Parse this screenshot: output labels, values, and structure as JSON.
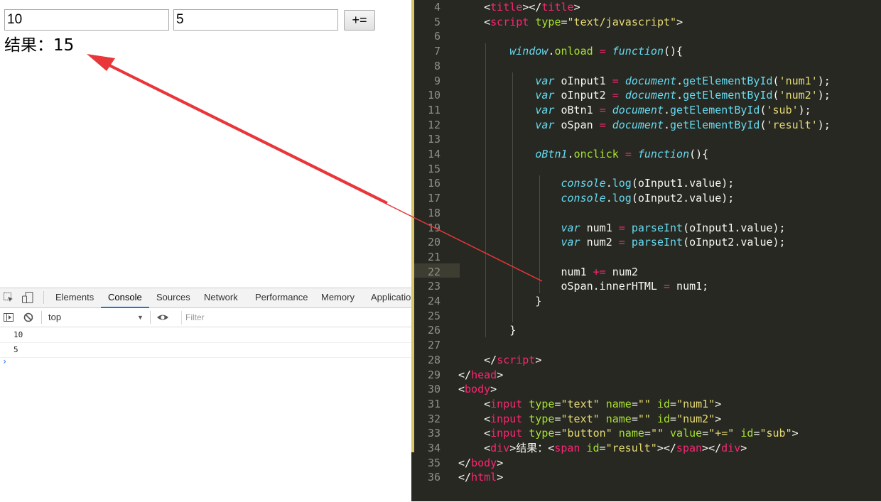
{
  "page": {
    "input1_value": "10",
    "input2_value": "5",
    "button_label": "+=",
    "result_text": "结果：15"
  },
  "devtools": {
    "tabs": [
      "Elements",
      "Console",
      "Sources",
      "Network",
      "Performance",
      "Memory",
      "Application"
    ],
    "active_tab": "Console",
    "context": "top",
    "filter_placeholder": "Filter",
    "logs": [
      "10",
      "5"
    ],
    "prompt": "›"
  },
  "editor": {
    "lines": [
      {
        "n": "4",
        "html": "    <span class='p'>&lt;</span><span class='t'>title</span><span class='p'>&gt;&lt;/</span><span class='t'>title</span><span class='p'>&gt;</span>"
      },
      {
        "n": "5",
        "html": "    <span class='p'>&lt;</span><span class='t'>script</span> <span class='a'>type</span><span class='p'>=</span><span class='s'>\"text/javascript\"</span><span class='p'>&gt;</span>"
      },
      {
        "n": "6",
        "html": ""
      },
      {
        "n": "7",
        "html": "        <span class='i'>window</span>.<span class='g'>onload</span> <span class='o'>=</span> <span class='i'>function</span>(){"
      },
      {
        "n": "8",
        "html": ""
      },
      {
        "n": "9",
        "html": "            <span class='i'>var</span> oInput1 <span class='o'>=</span> <span class='i'>document</span>.<span class='f'>getElementById</span>(<span class='s'>'num1'</span>);"
      },
      {
        "n": "10",
        "html": "            <span class='i'>var</span> oInput2 <span class='o'>=</span> <span class='i'>document</span>.<span class='f'>getElementById</span>(<span class='s'>'num2'</span>);"
      },
      {
        "n": "11",
        "html": "            <span class='i'>var</span> oBtn1 <span class='o'>=</span> <span class='i'>document</span>.<span class='f'>getElementById</span>(<span class='s'>'sub'</span>);"
      },
      {
        "n": "12",
        "html": "            <span class='i'>var</span> oSpan <span class='o'>=</span> <span class='i'>document</span>.<span class='f'>getElementById</span>(<span class='s'>'result'</span>);"
      },
      {
        "n": "13",
        "html": ""
      },
      {
        "n": "14",
        "html": "            <span class='i'>oBtn1</span>.<span class='g'>onclick</span> <span class='o'>=</span> <span class='i'>function</span>(){"
      },
      {
        "n": "15",
        "html": ""
      },
      {
        "n": "16",
        "html": "                <span class='i'>console</span>.<span class='f'>log</span>(oInput1.value);"
      },
      {
        "n": "17",
        "html": "                <span class='i'>console</span>.<span class='f'>log</span>(oInput2.value);"
      },
      {
        "n": "18",
        "html": ""
      },
      {
        "n": "19",
        "html": "                <span class='i'>var</span> num1 <span class='o'>=</span> <span class='f'>parseInt</span>(oInput1.value);"
      },
      {
        "n": "20",
        "html": "                <span class='i'>var</span> num2 <span class='o'>=</span> <span class='f'>parseInt</span>(oInput2.value);"
      },
      {
        "n": "21",
        "html": ""
      },
      {
        "n": "22",
        "html": "                num1 <span class='o'>+=</span> num2"
      },
      {
        "n": "23",
        "html": "                oSpan.innerHTML <span class='o'>=</span> num1;"
      },
      {
        "n": "24",
        "html": "            }"
      },
      {
        "n": "25",
        "html": ""
      },
      {
        "n": "26",
        "html": "        }"
      },
      {
        "n": "27",
        "html": ""
      },
      {
        "n": "28",
        "html": "    <span class='p'>&lt;/</span><span class='t'>script</span><span class='p'>&gt;</span>"
      },
      {
        "n": "29",
        "html": "<span class='p'>&lt;/</span><span class='t'>head</span><span class='p'>&gt;</span>"
      },
      {
        "n": "30",
        "html": "<span class='p'>&lt;</span><span class='t'>body</span><span class='p'>&gt;</span>"
      },
      {
        "n": "31",
        "html": "    <span class='p'>&lt;</span><span class='t'>input</span> <span class='a'>type</span><span class='p'>=</span><span class='s'>\"text\"</span> <span class='a'>name</span><span class='p'>=</span><span class='s'>\"\"</span> <span class='a'>id</span><span class='p'>=</span><span class='s'>\"num1\"</span><span class='p'>&gt;</span>"
      },
      {
        "n": "32",
        "html": "    <span class='p'>&lt;</span><span class='t'>input</span> <span class='a'>type</span><span class='p'>=</span><span class='s'>\"text\"</span> <span class='a'>name</span><span class='p'>=</span><span class='s'>\"\"</span> <span class='a'>id</span><span class='p'>=</span><span class='s'>\"num2\"</span><span class='p'>&gt;</span>"
      },
      {
        "n": "33",
        "html": "    <span class='p'>&lt;</span><span class='t'>input</span> <span class='a'>type</span><span class='p'>=</span><span class='s'>\"button\"</span> <span class='a'>name</span><span class='p'>=</span><span class='s'>\"\"</span> <span class='a'>value</span><span class='p'>=</span><span class='s'>\"+=\"</span> <span class='a'>id</span><span class='p'>=</span><span class='s'>\"sub\"</span><span class='p'>&gt;</span>"
      },
      {
        "n": "34",
        "html": "    <span class='p'>&lt;</span><span class='t'>div</span><span class='p'>&gt;</span>结果：<span class='p'>&lt;</span><span class='t'>span</span> <span class='a'>id</span><span class='p'>=</span><span class='s'>\"result\"</span><span class='p'>&gt;&lt;/</span><span class='t'>span</span><span class='p'>&gt;&lt;/</span><span class='t'>div</span><span class='p'>&gt;</span>"
      },
      {
        "n": "35",
        "html": "<span class='p'>&lt;/</span><span class='t'>body</span><span class='p'>&gt;</span>"
      },
      {
        "n": "36",
        "html": "<span class='p'>&lt;/</span><span class='t'>html</span><span class='p'>&gt;</span>"
      }
    ]
  },
  "colors": {
    "editor_bg": "#272822",
    "annotation_arrow": "#e8363a",
    "devtools_accent": "#1a73e8"
  }
}
